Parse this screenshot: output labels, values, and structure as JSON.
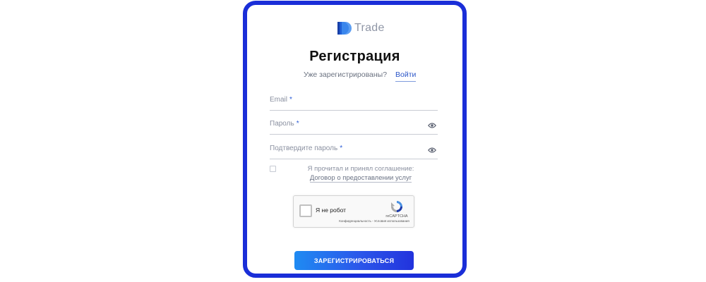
{
  "brand": {
    "logo_icon": "trade-logo-icon",
    "name": "Trade"
  },
  "form": {
    "title": "Регистрация",
    "already_registered": "Уже зарегистрированы?",
    "login_link": "Войти",
    "fields": [
      {
        "label": "Email",
        "required_mark": "*",
        "has_visibility_toggle": false
      },
      {
        "label": "Пароль",
        "required_mark": "*",
        "has_visibility_toggle": true,
        "icon": "eye-icon"
      },
      {
        "label": "Подтвердите пароль",
        "required_mark": "*",
        "has_visibility_toggle": true,
        "icon": "eye-icon"
      }
    ],
    "agreement": {
      "checked": false,
      "text": "Я прочитал и принял соглашение:",
      "link_text": "Договор о предоставлении услуг"
    },
    "recaptcha": {
      "label": "Я не робот",
      "brand": "reCAPTCHA",
      "terms": "Конфиденциальность - Условия использования",
      "icon": "recaptcha-logo-icon"
    },
    "submit_label": "ЗАРЕГИСТРИРОВАТЬСЯ"
  },
  "colors": {
    "frame_border": "#1a2ed8",
    "link": "#2a55c8",
    "required": "#2b5cd6",
    "button_gradient_start": "#1f8bf2",
    "button_gradient_end": "#2233dd"
  }
}
